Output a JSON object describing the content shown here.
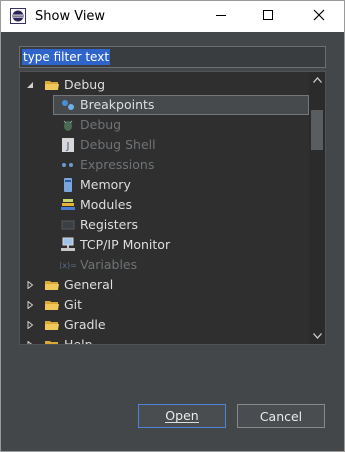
{
  "window": {
    "title": "Show View",
    "app_icon": "eclipse-icon"
  },
  "filter": {
    "value": "type filter text"
  },
  "tree": {
    "items": [
      {
        "label": "Debug",
        "expanded": true,
        "icon": "folder-icon",
        "level": 0,
        "disabled": false
      },
      {
        "label": "Breakpoints",
        "icon": "breakpoints-icon",
        "level": 1,
        "selected": true,
        "disabled": false
      },
      {
        "label": "Debug",
        "icon": "debug-icon",
        "level": 1,
        "disabled": true
      },
      {
        "label": "Debug Shell",
        "icon": "debug-shell-icon",
        "level": 1,
        "disabled": true
      },
      {
        "label": "Expressions",
        "icon": "expressions-icon",
        "level": 1,
        "disabled": true
      },
      {
        "label": "Memory",
        "icon": "memory-icon",
        "level": 1,
        "disabled": false
      },
      {
        "label": "Modules",
        "icon": "modules-icon",
        "level": 1,
        "disabled": false
      },
      {
        "label": "Registers",
        "icon": "registers-icon",
        "level": 1,
        "disabled": false
      },
      {
        "label": "TCP/IP Monitor",
        "icon": "tcpip-monitor-icon",
        "level": 1,
        "disabled": false
      },
      {
        "label": "Variables",
        "icon": "variables-icon",
        "level": 1,
        "disabled": true
      },
      {
        "label": "General",
        "expanded": false,
        "icon": "folder-icon",
        "level": 0,
        "disabled": false
      },
      {
        "label": "Git",
        "expanded": false,
        "icon": "folder-icon",
        "level": 0,
        "disabled": false
      },
      {
        "label": "Gradle",
        "expanded": false,
        "icon": "folder-icon",
        "level": 0,
        "disabled": false
      },
      {
        "label": "Help",
        "expanded": false,
        "icon": "folder-icon",
        "level": 0,
        "disabled": false
      }
    ]
  },
  "buttons": {
    "open": "Open",
    "cancel": "Cancel"
  },
  "colors": {
    "dialog_bg": "#434749",
    "tree_bg": "#2f2f2f",
    "selection": "#2f65ca",
    "folder": "#e8b84a"
  }
}
